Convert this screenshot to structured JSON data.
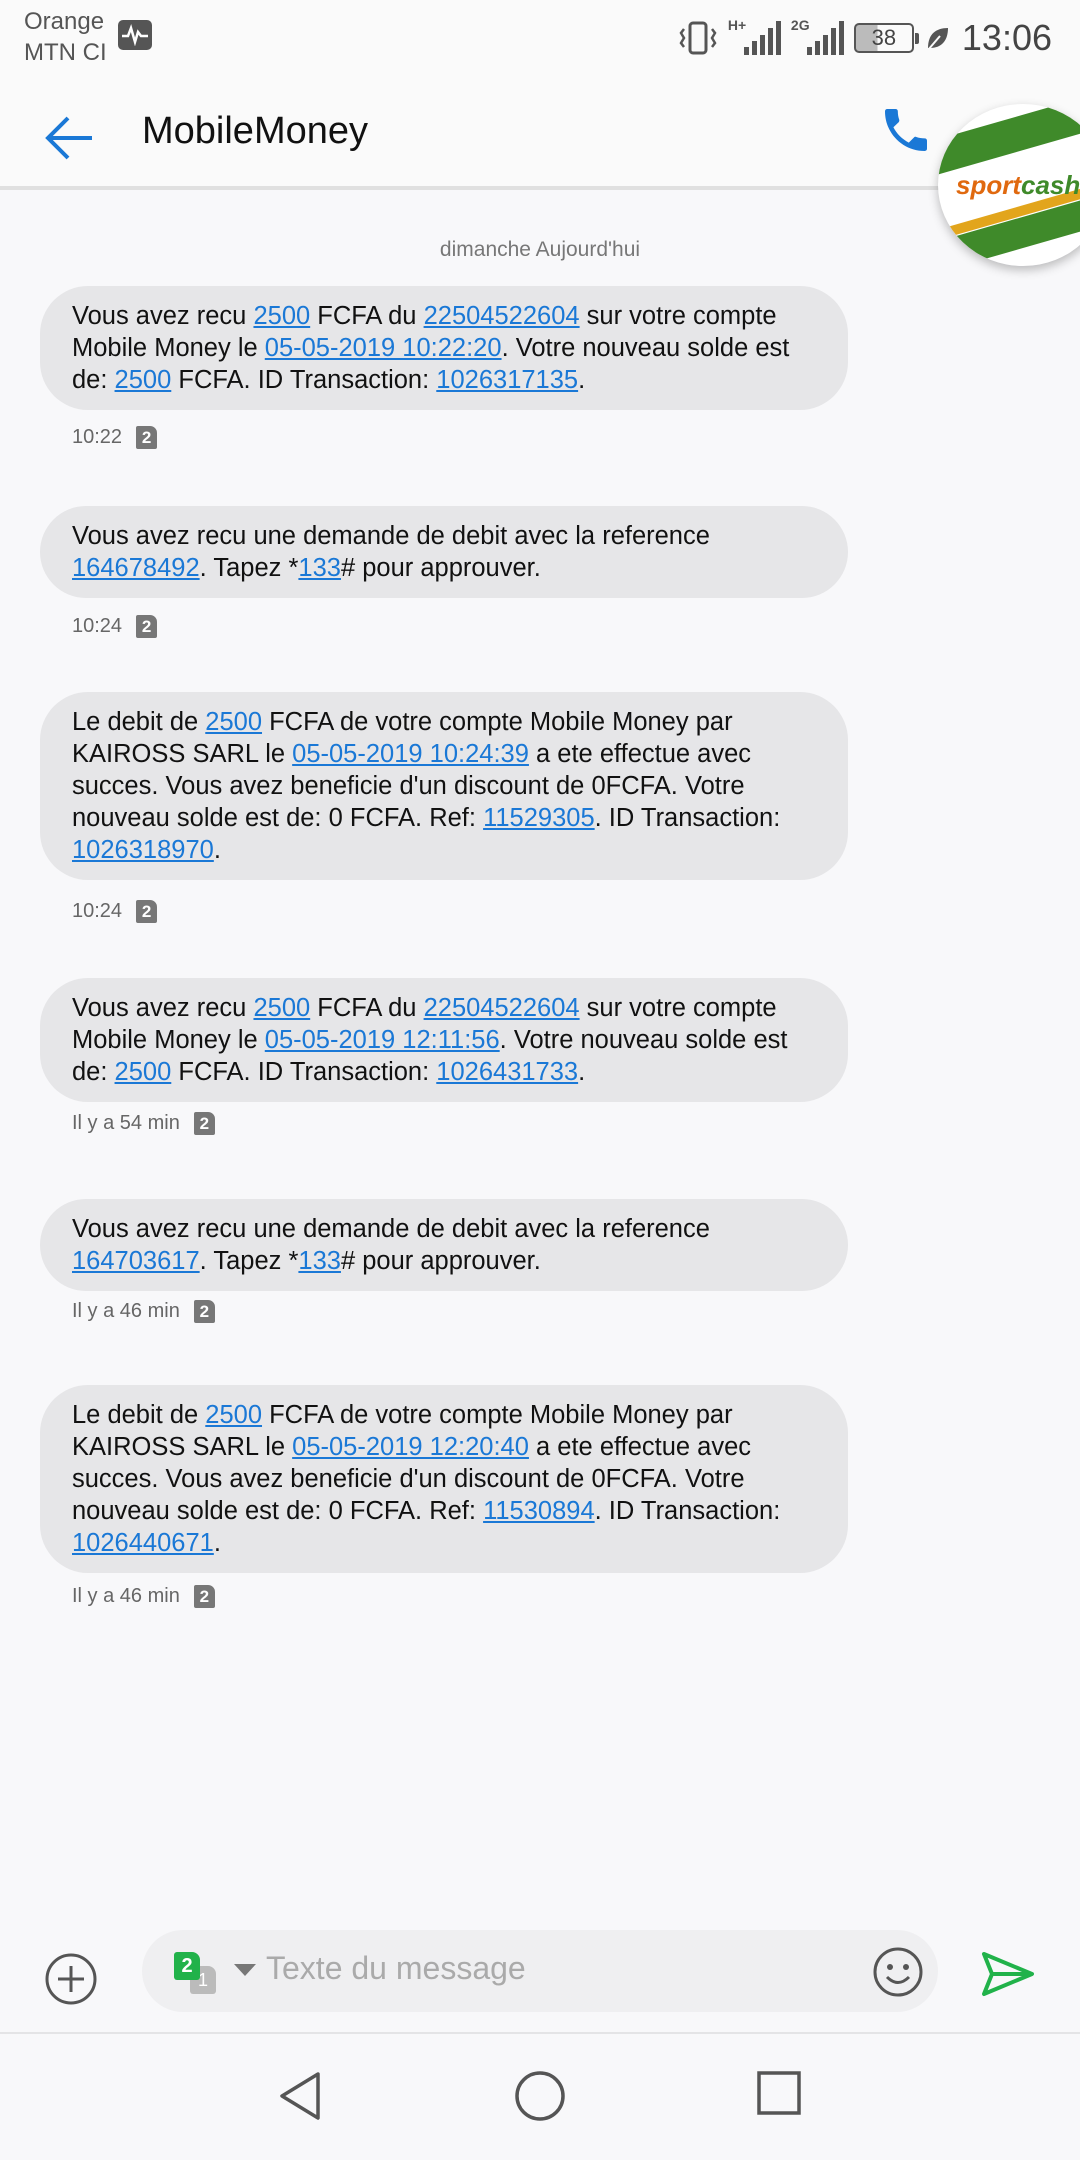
{
  "status_bar": {
    "carrier1": "Orange",
    "carrier2": "MTN CI",
    "network1": "H+",
    "network2": "2G",
    "battery": "38",
    "time": "13:06"
  },
  "header": {
    "title": "MobileMoney",
    "chat_head_logo_a": "sport",
    "chat_head_logo_b": "cash"
  },
  "thread": {
    "date_separator": "dimanche Aujourd'hui",
    "messages": [
      {
        "parts": [
          {
            "t": "Vous avez recu "
          },
          {
            "t": "2500",
            "link": true
          },
          {
            "t": " FCFA du "
          },
          {
            "t": "22504522604",
            "link": true
          },
          {
            "t": " sur votre compte Mobile Money le "
          },
          {
            "t": "05-05-2019 10:22:20",
            "link": true
          },
          {
            "t": ". Votre nouveau solde est de: "
          },
          {
            "t": "2500",
            "link": true
          },
          {
            "t": " FCFA. ID Transaction: "
          },
          {
            "t": "1026317135",
            "link": true
          },
          {
            "t": "."
          }
        ],
        "time": "10:22",
        "sim": "2"
      },
      {
        "parts": [
          {
            "t": "Vous avez recu une demande de debit avec la reference "
          },
          {
            "t": "164678492",
            "link": true
          },
          {
            "t": ". Tapez *"
          },
          {
            "t": "133",
            "link": true
          },
          {
            "t": "# pour approuver."
          }
        ],
        "time": "10:24",
        "sim": "2"
      },
      {
        "parts": [
          {
            "t": "Le debit de "
          },
          {
            "t": "2500",
            "link": true
          },
          {
            "t": " FCFA de votre compte Mobile Money par KAIROSS SARL le "
          },
          {
            "t": "05-05-2019 10:24:39",
            "link": true
          },
          {
            "t": " a ete effectue avec succes. Vous avez beneficie d'un discount de 0FCFA.  Votre nouveau solde est de: 0 FCFA. Ref: "
          },
          {
            "t": "11529305",
            "link": true
          },
          {
            "t": ". ID Transaction: "
          },
          {
            "t": "1026318970",
            "link": true
          },
          {
            "t": "."
          }
        ],
        "time": "10:24",
        "sim": "2"
      },
      {
        "parts": [
          {
            "t": "Vous avez recu "
          },
          {
            "t": "2500",
            "link": true
          },
          {
            "t": " FCFA du "
          },
          {
            "t": "22504522604",
            "link": true
          },
          {
            "t": " sur votre compte Mobile Money le "
          },
          {
            "t": "05-05-2019 12:11:56",
            "link": true
          },
          {
            "t": ". Votre nouveau solde est de: "
          },
          {
            "t": "2500",
            "link": true
          },
          {
            "t": " FCFA. ID Transaction: "
          },
          {
            "t": "1026431733",
            "link": true
          },
          {
            "t": "."
          }
        ],
        "time": "Il y a 54 min",
        "sim": "2"
      },
      {
        "parts": [
          {
            "t": "Vous avez recu une demande de debit avec la reference "
          },
          {
            "t": "164703617",
            "link": true
          },
          {
            "t": ". Tapez *"
          },
          {
            "t": "133",
            "link": true
          },
          {
            "t": "# pour approuver."
          }
        ],
        "time": "Il y a 46 min",
        "sim": "2"
      },
      {
        "parts": [
          {
            "t": "Le debit de "
          },
          {
            "t": "2500",
            "link": true
          },
          {
            "t": " FCFA de votre compte Mobile Money par KAIROSS SARL le "
          },
          {
            "t": "05-05-2019 12:20:40",
            "link": true
          },
          {
            "t": " a ete effectue avec succes. Vous avez beneficie d'un discount de 0FCFA.  Votre nouveau solde est de: 0 FCFA. Ref: "
          },
          {
            "t": "11530894",
            "link": true
          },
          {
            "t": ". ID Transaction: "
          },
          {
            "t": "1026440671",
            "link": true
          },
          {
            "t": "."
          }
        ],
        "time": "Il y a 46 min",
        "sim": "2"
      }
    ]
  },
  "composer": {
    "sim_selected": "2",
    "sim_other": "1",
    "placeholder": "Texte du message"
  },
  "icons": {
    "back": "arrow-left-icon",
    "call": "phone-icon",
    "add": "plus-circle-icon",
    "emoji": "smiley-icon",
    "send": "send-icon"
  },
  "colors": {
    "accent": "#1a78d6",
    "bubble": "#e6e6e8",
    "send": "#21b24a"
  }
}
